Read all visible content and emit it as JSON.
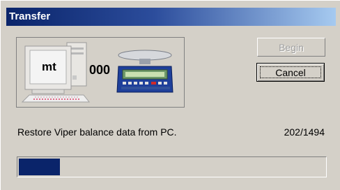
{
  "window": {
    "title": "Transfer"
  },
  "illustration": {
    "pc_label": "mt",
    "link_text": "000"
  },
  "buttons": {
    "begin_label": "Begin",
    "cancel_label": "Cancel"
  },
  "status": {
    "message": "Restore Viper balance data from PC.",
    "count": "202/1494"
  },
  "progress": {
    "fraction": 0.135
  },
  "colors": {
    "title_start": "#0a246a",
    "title_end": "#a6caf0",
    "progress_fill": "#0a246a",
    "dialog_bg": "#d4d0c8"
  },
  "icons": [
    "pc-icon",
    "balance-scale-icon"
  ]
}
